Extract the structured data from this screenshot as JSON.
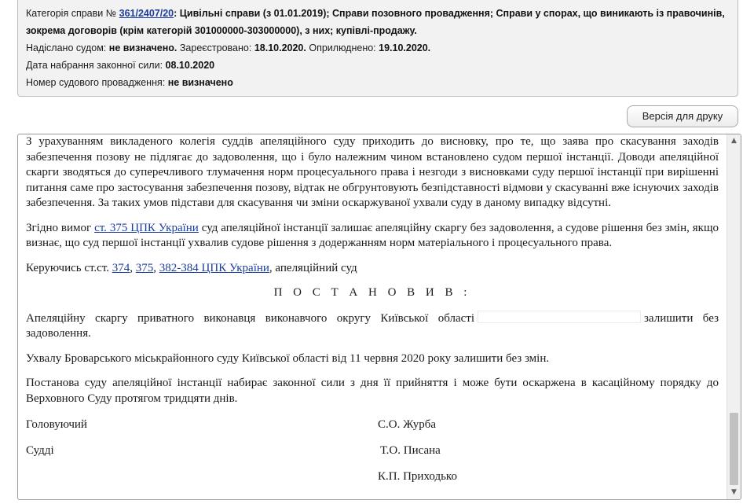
{
  "meta": {
    "category_label": "Категорія справи №",
    "case_number": "361/2407/20",
    "category_value": ": Цивільні справи (з 01.01.2019); Справи позовного провадження; Справи у спорах, що виникають із правочинів,",
    "category_value_cont": "зокрема договорів (крім категорій 301000000-303000000), з них; купівлі-продажу.",
    "sent_label": "Надіслано судом:",
    "sent_value": "не визначено.",
    "registered_label": "Зареєстровано:",
    "registered_value": "18.10.2020.",
    "published_label": "Оприлюднено:",
    "published_value": "19.10.2020.",
    "force_label": "Дата набрання законної сили:",
    "force_value": "08.10.2020",
    "proceeding_label": "Номер судового провадження:",
    "proceeding_value": "не визначено"
  },
  "print_button": "Версія для друку",
  "document": {
    "para1": "З урахуванням викладеного колегія суддів апеляційного суду приходить до висновку, про те, що заява про скасування заходів забезпечення позову не підлягає до задоволення, що і було належним чином встановлено судом першої інстанції. Доводи апеляційної скарги зводяться до суперечливого тлумачення норм процесуального права і незгоди з висновками суду першої інстанції при вирішенні питання саме про застосування забезпечення позову, відтак не обгрунтовують безпідставності відмови у скасуванні вже існуючих заходів забезпечення. За таких умов підстави для скасування чи зміни оскаржуваної ухвали суду в даному випадку відсутні.",
    "para2_before": "Згідно вимог ",
    "para2_link": "ст. 375 ЦПК України",
    "para2_after": " суд апеляційної інстанції залишає апеляційну скаргу без задоволення, а судове рішення без змін, якщо визнає, що суд першої інстанції ухвалив судове рішення з додержанням норм матеріального і процесуального права.",
    "para3_before": "Керуючись ст.ст. ",
    "para3_link1": "374",
    "para3_sep1": ", ",
    "para3_link2": "375",
    "para3_sep2": ", ",
    "para3_link3": "382-384 ЦПК України",
    "para3_after": ", апеляційний суд",
    "heading": "П О С Т А Н О В И В :",
    "para4_before": "Апеляційну скаргу приватного виконавця виконавчого округу Київської області",
    "para4_after": "залишити без задоволення.",
    "para5": "Ухвалу Броварського міськрайонного суду Київської області від 11 червня 2020 року залишити без змін.",
    "para6": "Постанова суду апеляційної інстанції набирає законної сили з дня її прийняття і може бути оскаржена в касаційному порядку до Верховного Суду протягом тридцяти днів.",
    "sign_role_1": "Головуючий",
    "sign_name_1": "С.О. Журба",
    "sign_role_2": "Судді",
    "sign_name_2": "Т.О. Писана",
    "sign_name_3": "К.П. Приходько"
  },
  "scrollbar": {
    "up_icon": "triangle-up",
    "down_icon": "triangle-down"
  }
}
